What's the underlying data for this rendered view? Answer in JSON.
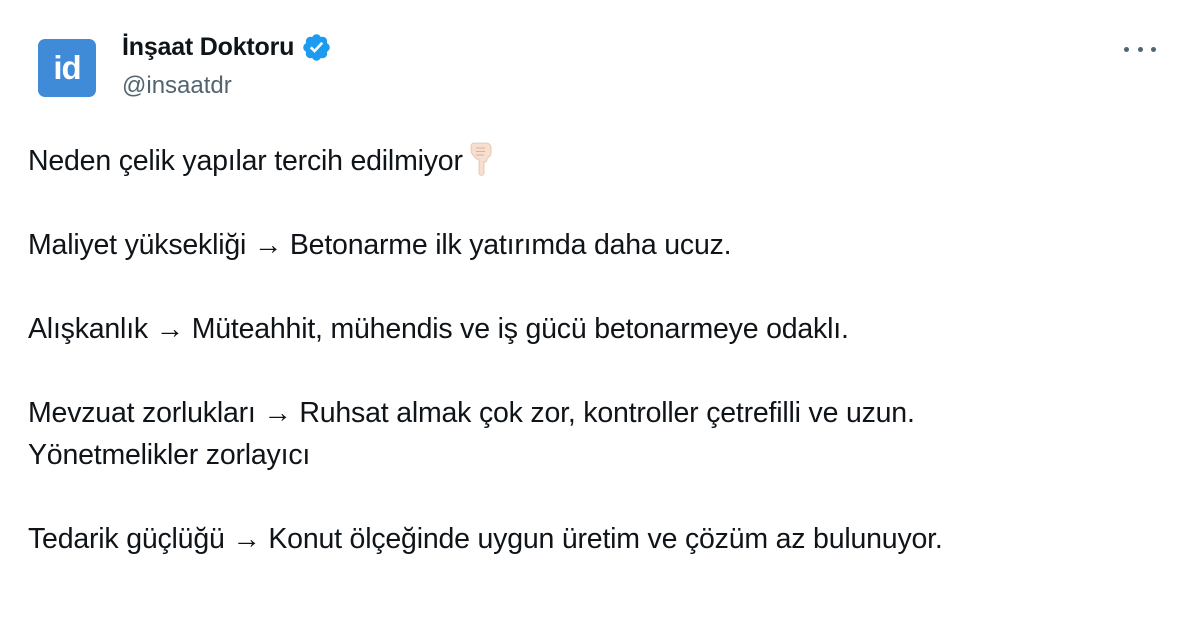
{
  "author": {
    "avatar_text": "id",
    "display_name": "İnşaat Doktoru",
    "handle": "@insaatdr",
    "verified_icon": "verified-badge-icon",
    "brand_color": "#3f8bd8",
    "verified_color": "#1d9bf0"
  },
  "menu": {
    "icon": "more-horizontal-icon"
  },
  "tweet": {
    "line1": "Neden çelik yapılar tercih edilmiyor",
    "line1_emoji": "pointing-down-hand-icon",
    "line2": "Maliyet yüksekliği → Betonarme ilk yatırımda daha ucuz.",
    "line3": "Alışkanlık → Müteahhit, mühendis ve iş gücü betonarmeye odaklı.",
    "line4a": "Mevzuat zorlukları → Ruhsat almak çok zor, kontroller çetrefilli ve uzun.",
    "line4b": "Yönetmelikler zorlayıcı",
    "line5": "Tedarik güçlüğü → Konut ölçeğinde uygun üretim ve çözüm az bulunuyor."
  }
}
